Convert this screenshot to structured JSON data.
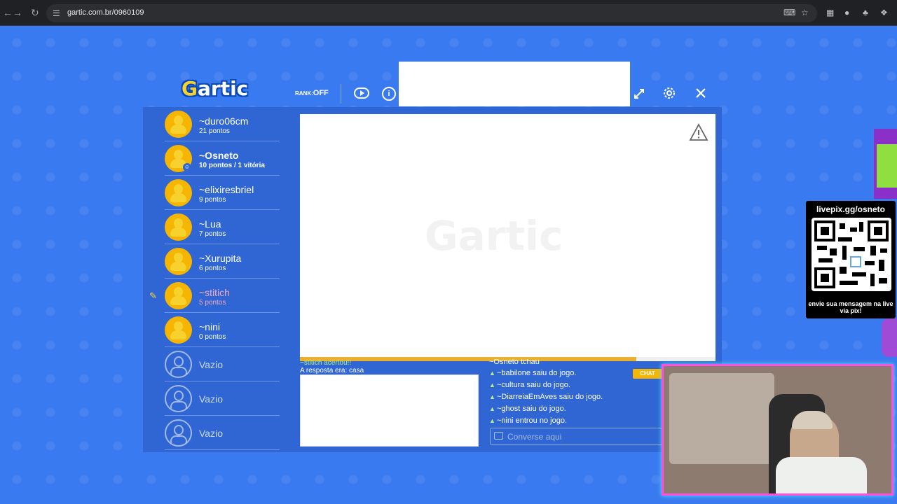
{
  "browser": {
    "url": "gartic.com.br/0960109",
    "back_icon": "arrow-left",
    "forward_icon": "arrow-right",
    "reload_icon": "reload"
  },
  "header": {
    "logo_prefix": "G",
    "logo_rest": "artic",
    "rank_label": "RANK:",
    "rank_value": "OFF"
  },
  "players": [
    {
      "name": "~duro06cm",
      "points": "21 pontos",
      "state": "normal"
    },
    {
      "name": "~Osneto",
      "points": "10 pontos / 1 vitória",
      "state": "me"
    },
    {
      "name": "~elixiresbriel",
      "points": "9 pontos",
      "state": "normal"
    },
    {
      "name": "~Lua",
      "points": "7 pontos",
      "state": "normal"
    },
    {
      "name": "~Xurupita",
      "points": "6 pontos",
      "state": "normal"
    },
    {
      "name": "~stitich",
      "points": "5 pontos",
      "state": "drawing"
    },
    {
      "name": "~nini",
      "points": "0 pontos",
      "state": "normal"
    },
    {
      "name": "Vazio",
      "points": "",
      "state": "empty"
    },
    {
      "name": "Vazio",
      "points": "",
      "state": "empty"
    },
    {
      "name": "Vazio",
      "points": "",
      "state": "empty"
    }
  ],
  "canvas": {
    "watermark": "Gartic",
    "time_progress_fraction": 0.81
  },
  "answers": {
    "lines": [
      "~stitich acertou!!",
      "A resposta era: casa"
    ]
  },
  "chat": {
    "tag": "CHAT",
    "messages": [
      "~Osneto tchau",
      "~babilone saiu do jogo.",
      "~cultura saiu do jogo.",
      "~DiarreiaEmAves saiu do jogo.",
      "~ghost saiu do jogo.",
      "~nini entrou no jogo."
    ],
    "input_placeholder": "Converse aqui"
  },
  "overlay": {
    "pix_title": "livepix.gg/osneto",
    "pix_caption": "envie sua mensagem na live via pix!"
  },
  "colors": {
    "background": "#3a7af0",
    "panel": "#2f66d3",
    "accent_yellow": "#f5b500",
    "drawing_player": "#f7a8c7"
  }
}
